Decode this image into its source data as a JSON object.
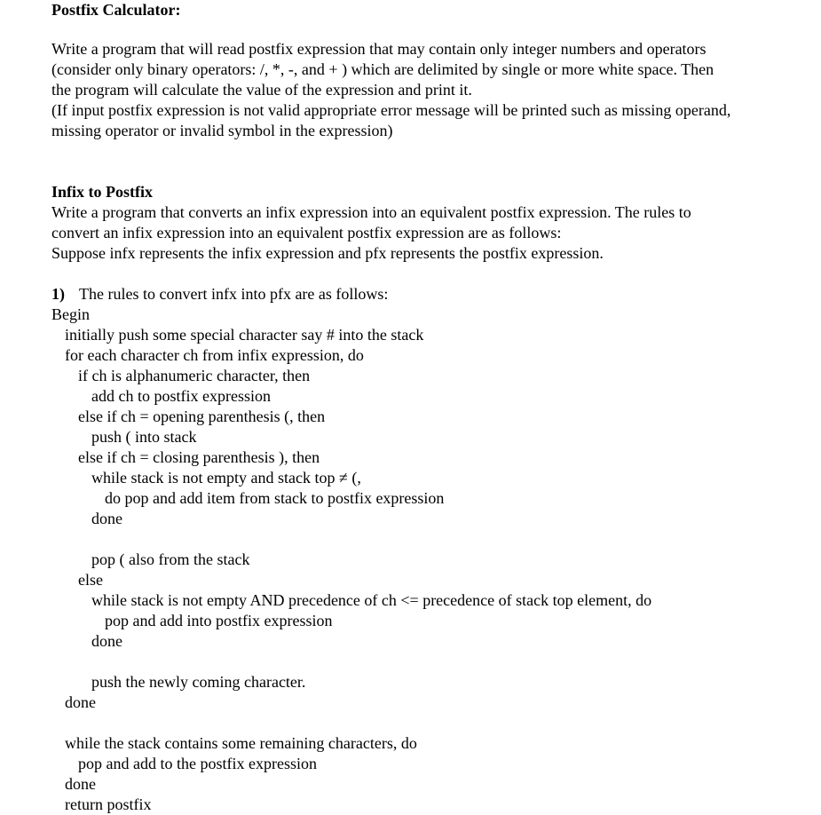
{
  "section1": {
    "title": "Postfix Calculator:",
    "paragraph": [
      "Write a program that will read postfix expression that may contain only integer numbers and operators",
      "(consider only binary operators: /, *, -, and + ) which are delimited by single or more white space. Then",
      "the program will calculate the value of the expression and print it.",
      "(If input postfix expression is not valid appropriate error message will be printed such as missing operand,",
      "missing operator or invalid symbol in the expression)"
    ]
  },
  "section2": {
    "title": "Infix to Postfix",
    "paragraph": [
      "Write a program that converts an infix expression into an equivalent postfix expression. The rules to",
      "convert an infix expression into an equivalent postfix expression are as follows:",
      "Suppose infx represents the infix expression and pfx represents the postfix expression."
    ],
    "rules_number": "1)",
    "rules_heading": "The rules to convert infx into pfx are as follows:",
    "algorithm": [
      "Begin",
      "initially push some special character say # into the stack",
      "for each character ch from infix expression, do",
      "if ch is alphanumeric character, then",
      "add ch to postfix expression",
      "else if ch = opening parenthesis (, then",
      "push ( into stack",
      "else if ch = closing parenthesis ), then",
      "while stack is not empty and stack top ≠ (,",
      "do pop and add item from stack to postfix expression",
      "done",
      "pop ( also from the stack",
      "else",
      "while stack is not empty AND precedence of ch <= precedence of stack top element, do",
      "pop and add into postfix expression",
      "done",
      "push the newly coming character.",
      "done",
      "while the stack contains some remaining characters, do",
      "pop and add to the postfix expression",
      "done",
      "return postfix"
    ]
  }
}
